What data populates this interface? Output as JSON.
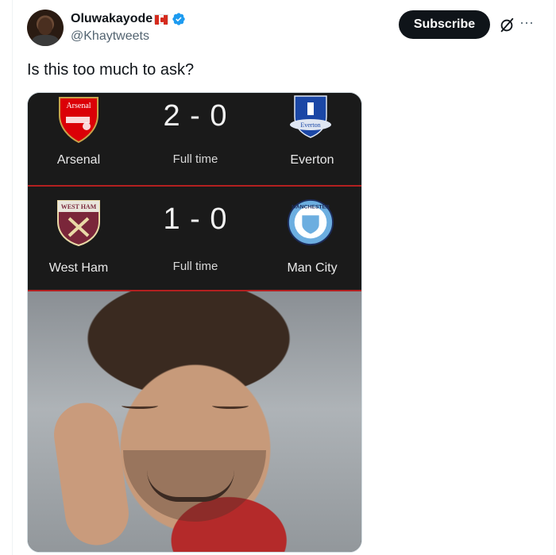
{
  "author": {
    "display_name": "Oluwakayode",
    "handle": "@Khaytweets",
    "verified": true,
    "flag_icon": "canada-flag-icon"
  },
  "actions": {
    "subscribe_label": "Subscribe",
    "grok_icon": "grok-icon",
    "more_icon": "more-options-icon"
  },
  "tweet": {
    "text": "Is this too much to ask?"
  },
  "media": {
    "matches": [
      {
        "home": "Arsenal",
        "away": "Everton",
        "score": "2 - 0",
        "status": "Full time",
        "home_crest_text": "Arsenal",
        "away_crest_text": "Everton"
      },
      {
        "home": "West Ham",
        "away": "Man City",
        "score": "1 - 0",
        "status": "Full time",
        "home_crest_text": "WEST HAM",
        "away_crest_text": "MANCHESTER"
      }
    ]
  },
  "colors": {
    "accent_blue": "#1d9bf0",
    "card_bg": "#1a1a1a",
    "divider_red": "#b32020"
  }
}
